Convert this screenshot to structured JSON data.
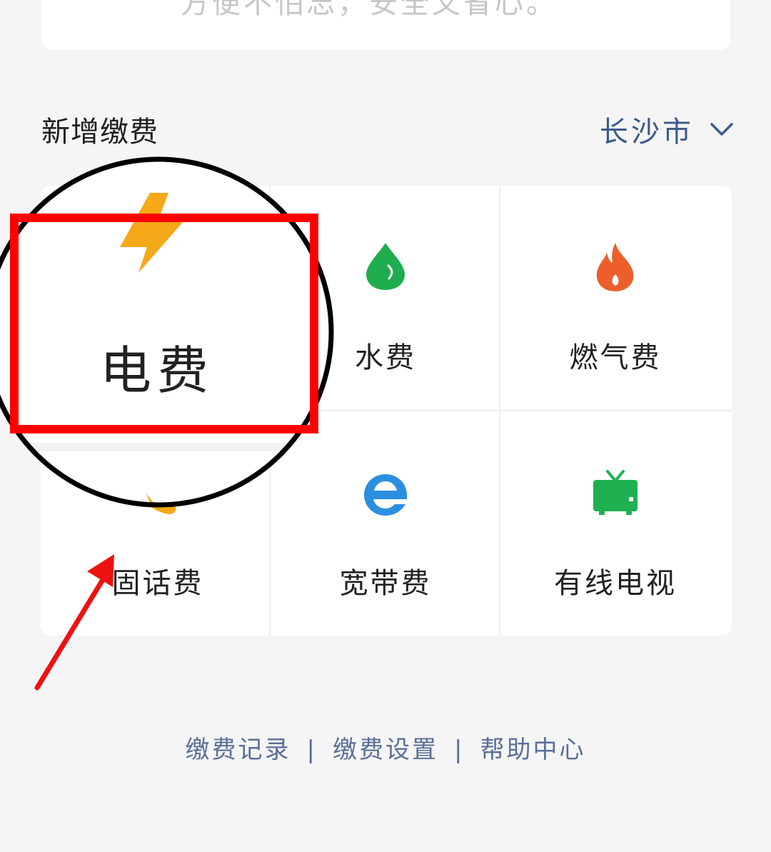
{
  "top_card": {
    "tagline": "方便不怕忘，安全又省心。",
    "logo_icon": "green-leaf-icon"
  },
  "section": {
    "title": "新增缴费"
  },
  "city_selector": {
    "value": "长沙市",
    "icon": "chevron-down-icon"
  },
  "tiles": [
    {
      "label": "电费",
      "icon": "lightning-icon",
      "color": "#f5a818"
    },
    {
      "label": "水费",
      "icon": "water-drop-icon",
      "color": "#1fad4e"
    },
    {
      "label": "燃气费",
      "icon": "flame-icon",
      "color": "#ec5f2c"
    },
    {
      "label": "固话费",
      "icon": "phone-icon",
      "color": "#f5a818"
    },
    {
      "label": "宽带费",
      "icon": "browser-e-icon",
      "color": "#2b8fe0"
    },
    {
      "label": "有线电视",
      "icon": "tv-icon",
      "color": "#1fb052"
    }
  ],
  "footer": {
    "links": [
      "缴费记录",
      "缴费设置",
      "帮助中心"
    ],
    "separator": "|"
  },
  "annotation": {
    "zoom_label": "电费",
    "highlight_color": "#ff0000",
    "arrow_color": "#ee1111"
  }
}
